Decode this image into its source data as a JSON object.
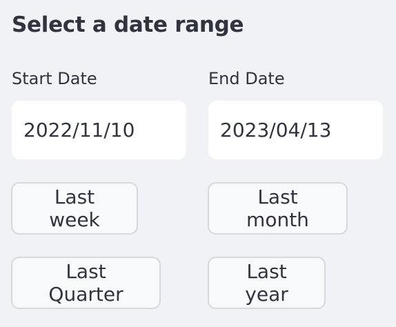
{
  "title": "Select a date range",
  "start": {
    "label": "Start Date",
    "value": "2022/11/10"
  },
  "end": {
    "label": "End Date",
    "value": "2023/04/13"
  },
  "presets": {
    "last_week": "Last week",
    "last_month": "Last month",
    "last_quarter": "Last Quarter",
    "last_year": "Last year"
  }
}
